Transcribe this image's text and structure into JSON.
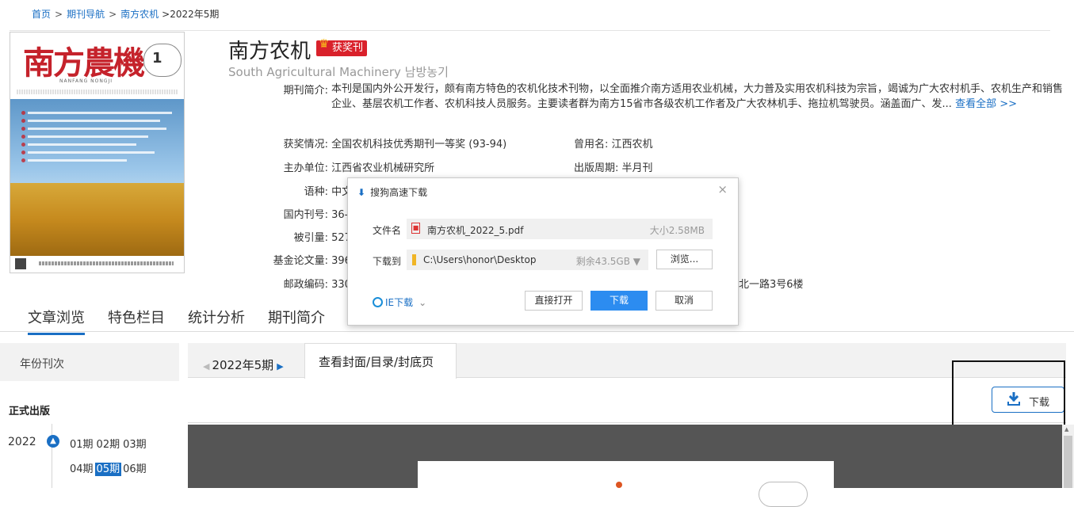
{
  "breadcrumb": {
    "home": "首页",
    "nav": "期刊导航",
    "journal": "南方农机",
    "current": ">2022年5期",
    "sep": ">"
  },
  "cover": {
    "logo_text": "南方農機",
    "logo_sub": "NANFANG NONGJI",
    "issue_num": "1"
  },
  "journal": {
    "title": "南方农机",
    "award_badge": "获奖刊",
    "subtitle": "South Agricultural Machinery 남방농기",
    "intro_label": "期刊简介:",
    "intro_text": "本刊是国内外公开发行，颇有南方特色的农机化技术刊物，以全面推介南方适用农业机械，大力普及实用农机科技为宗旨，竭诚为广大农村机手、农机生产和销售企业、基层农机工作者、农机科技人员服务。主要读者群为南方15省市各级农机工作者及广大农林机手、拖拉机驾驶员。涵盖面广、发...",
    "view_all": "查看全部 >>",
    "fields": {
      "award_label": "获奖情况:",
      "award_value": "全国农机科技优秀期刊一等奖 (93-94)",
      "former_label": "曾用名:",
      "former_value": "江西农机",
      "sponsor_label": "主办单位:",
      "sponsor_value": "江西省农业机械研究所",
      "cycle_label": "出版周期:",
      "cycle_value": "半月刊",
      "lang_label": "语种:",
      "lang_value": "中文",
      "cn_label": "国内刊号:",
      "cn_value": "36-",
      "cite_label": "被引量:",
      "cite_value": "527",
      "fund_label": "基金论文量:",
      "fund_value": "396",
      "post_label": "邮政编码:",
      "post_value": "330",
      "addr_tail": "北一路3号6楼"
    }
  },
  "main_tabs": [
    "文章浏览",
    "特色栏目",
    "统计分析",
    "期刊简介"
  ],
  "sidebar": {
    "year_head": "年份刊次",
    "pub_label": "正式出版",
    "year": "2022",
    "issues_row1": [
      "01期",
      "02期",
      "03期"
    ],
    "issues_row2": [
      "04期",
      "05期",
      "06期"
    ]
  },
  "panel": {
    "issue_nav": "2022年5期",
    "cover_tab": "查看封面/目录/封底页",
    "download_label": "下载"
  },
  "dialog": {
    "title": "搜狗高速下载",
    "close": "×",
    "fname_label": "文件名",
    "fname": "南方农机_2022_5.pdf",
    "fsize": "大小2.58MB",
    "dest_label": "下载到",
    "path": "C:\\Users\\honor\\Desktop",
    "free": "剩余43.5GB ▼",
    "browse": "浏览...",
    "ie_label": "IE下载",
    "open_direct": "直接打开",
    "download": "下载",
    "cancel": "取消"
  },
  "colors": {
    "link": "#1a6fc4",
    "badge_red": "#d9212b",
    "primary_btn": "#2c8cf0"
  }
}
